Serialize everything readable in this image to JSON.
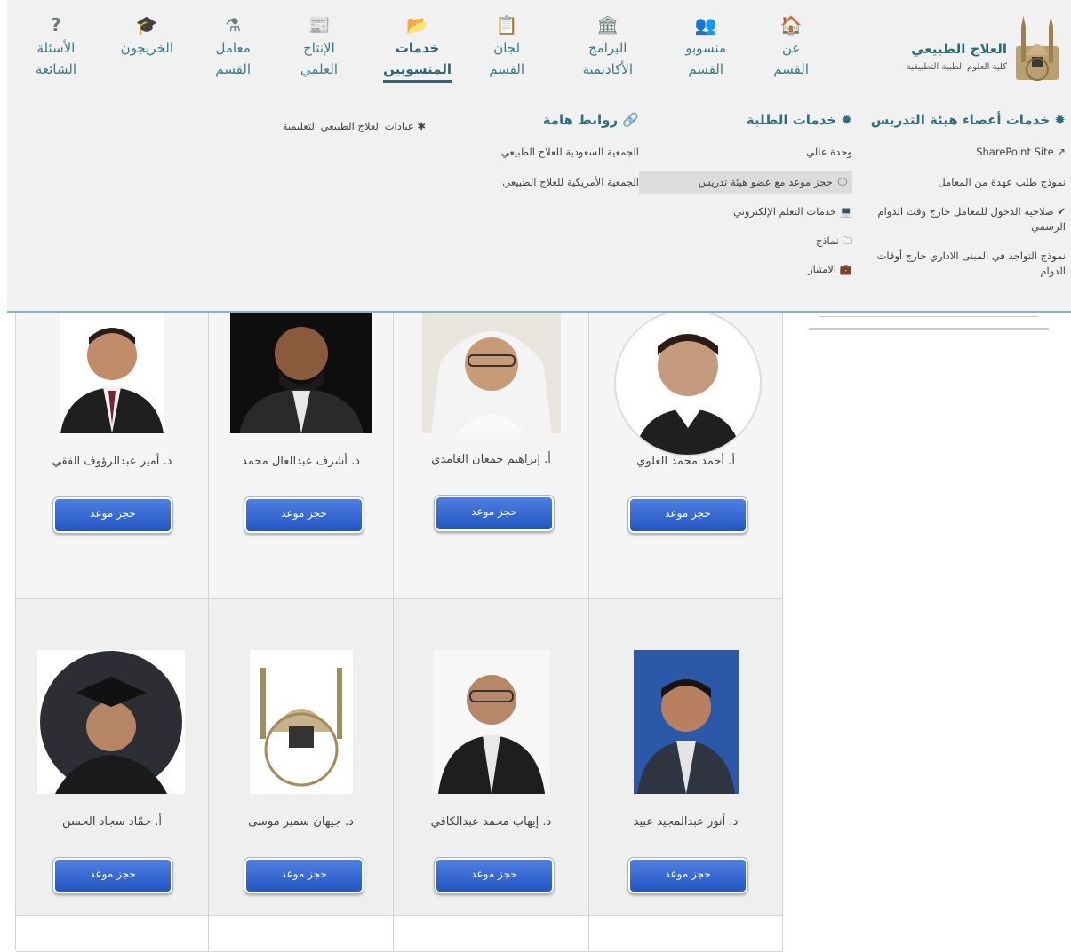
{
  "brand": {
    "title": "العلاج الطبيعي",
    "subtitle": "كلية العلوم الطبية التطبيقية",
    "logo_icon": "umm-al-qura-logo"
  },
  "nav": [
    {
      "label1": "عن",
      "label2": "القسم",
      "icon": "home-icon",
      "glyph": "🏠"
    },
    {
      "label1": "منسوبو",
      "label2": "القسم",
      "icon": "users-icon",
      "glyph": "👥"
    },
    {
      "label1": "البرامج",
      "label2": "الأكاديمية",
      "icon": "university-icon",
      "glyph": "🏛"
    },
    {
      "label1": "لجان",
      "label2": "القسم",
      "icon": "clipboard-icon",
      "glyph": "📋"
    },
    {
      "label1": "خدمات",
      "label2": "المنسوبين",
      "icon": "folder-open-icon",
      "glyph": "📂",
      "active": true
    },
    {
      "label1": "الإنتاج",
      "label2": "العلمي",
      "icon": "newspaper-icon",
      "glyph": "📰"
    },
    {
      "label1": "معامل",
      "label2": "القسم",
      "icon": "flask-icon",
      "glyph": "⚗"
    },
    {
      "label1": "الخريجون",
      "label2": "",
      "icon": "graduation-cap-icon",
      "glyph": "🎓"
    },
    {
      "label1": "الأسئلة",
      "label2": "الشائعة",
      "icon": "question-icon",
      "glyph": "?"
    }
  ],
  "mega": {
    "faculty": {
      "title": "خدمات أعضاء هيئة التدريس",
      "links": [
        "SharePoint Site",
        "نموذج طلب عهدة من المعامل",
        "صلاحية الدخول للمعامل خارج وقت الدوام الرسمي",
        "نموذج التواجد في المبنى الاداري خارج أوقات الدوام"
      ]
    },
    "students": {
      "title": "خدمات الطلبة",
      "links": [
        "وحدة عالي",
        "حجز موعد مع عضو هيئة تدريس",
        "خدمات التعلم الإلكتروني",
        "نماذج",
        "الامتياز"
      ]
    },
    "important": {
      "title": "روابط هامة",
      "links": [
        "الجمعية السعودية للعلاج الطبيعي",
        "الجمعية الأمريكية للعلاج الطبيعي"
      ]
    },
    "clinics": {
      "title": "عيادات العلاج الطبيعي التعليمية"
    }
  },
  "staff_row1": [
    {
      "name": "أ. أحمد محمد العلوي",
      "button": "حجز موعد"
    },
    {
      "name": "أ. إبراهيم جمعان الغامدي",
      "button": "حجز موعد"
    },
    {
      "name": "د. أشرف عبدالعال محمد",
      "button": "حجز موعد"
    },
    {
      "name": "د. أمير عبدالرؤوف الفقي",
      "button": "حجز موعد"
    }
  ],
  "staff_row2": [
    {
      "name": "د. أنور عبدالمجيد عبيد",
      "button": "حجز موعد"
    },
    {
      "name": "د. إيهاب محمد عبدالكافي",
      "button": "حجز موعد"
    },
    {
      "name": "د. جيهان سمير موسى",
      "button": "حجز موعد"
    },
    {
      "name": "أ. حمّاد سجاد الحسن",
      "button": "حجز موعد"
    }
  ],
  "colors": {
    "accent": "#2f6e7a",
    "button": "#2f5fd0"
  }
}
